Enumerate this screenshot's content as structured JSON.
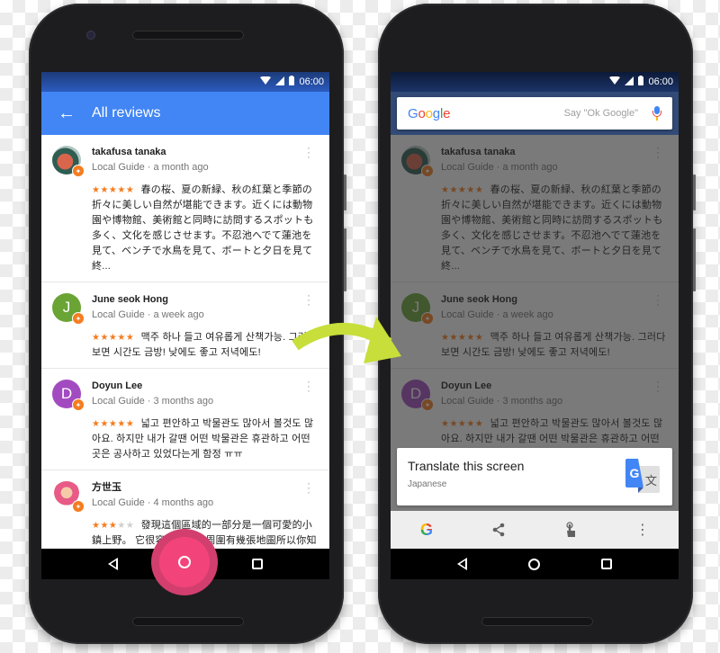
{
  "status_bar": {
    "time": "06:00"
  },
  "left_screen": {
    "app_bar": {
      "title": "All reviews"
    },
    "reviews": [
      {
        "name": "takafusa tanaka",
        "meta": "Local Guide · a month ago",
        "avatar_type": "photo",
        "avatar_color": "#6d8a7a",
        "initial": "",
        "rating": 5,
        "stars": "★★★★★",
        "stars_off": "",
        "text": "春の桜、夏の新緑、秋の紅葉と季節の折々に美しい自然が堪能できます。近くには動物園や博物館、美術館と同時に訪問するスポットも多く、文化を感じさせます。不忍池へでて蓮池を見て、ベンチで水鳥を見て、ボートと夕日を見て終..."
      },
      {
        "name": "June seok Hong",
        "meta": "Local Guide · a week ago",
        "avatar_type": "initial",
        "avatar_color": "#6aa435",
        "initial": "J",
        "rating": 5,
        "stars": "★★★★★",
        "stars_off": "",
        "text": "맥주 하나 들고 여유롭게 산책가능. 그러다 보면 시간도 금방! 낮에도 좋고 저녁에도!"
      },
      {
        "name": "Doyun Lee",
        "meta": "Local Guide · 3 months ago",
        "avatar_type": "initial",
        "avatar_color": "#a24bc1",
        "initial": "D",
        "rating": 5,
        "stars": "★★★★★",
        "stars_off": "",
        "text": "넓고 편안하고 박물관도 많아서 볼것도 많아요. 하지만 내가 갈땐 어떤 박물관은 휴관하고 어떤 곳은 공사하고 있었다는게 함정 ㅠㅠ"
      },
      {
        "name": "方世玉",
        "meta": "Local Guide · 4 months ago",
        "avatar_type": "photo",
        "avatar_color": "#f0a0b8",
        "initial": "",
        "rating": 3,
        "stars": "★★★",
        "stars_off": "★★",
        "text": "發現這個區域的一部分是一個可愛的小鎮上野。 它很容易步行去周圍有幾張地圖所以你知道你。 沿途可以看到有趣的東西和一個不錯的地方"
      }
    ]
  },
  "right_screen": {
    "search": {
      "logo": "Google",
      "hint": "Say \"Ok Google\""
    },
    "card": {
      "title": "Translate this screen",
      "subtitle": "Japanese",
      "icon_glyph_a": "G",
      "icon_glyph_b": "文"
    },
    "actions": [
      {
        "name": "google",
        "glyph": "G"
      },
      {
        "name": "share",
        "glyph": "⟨"
      },
      {
        "name": "select",
        "glyph": "☝"
      },
      {
        "name": "more",
        "glyph": "⋮"
      }
    ]
  },
  "colors": {
    "app_bar": "#4285f4",
    "star": "#f57c1f",
    "fab": "#f2447a",
    "arrow": "#c8de3a"
  }
}
